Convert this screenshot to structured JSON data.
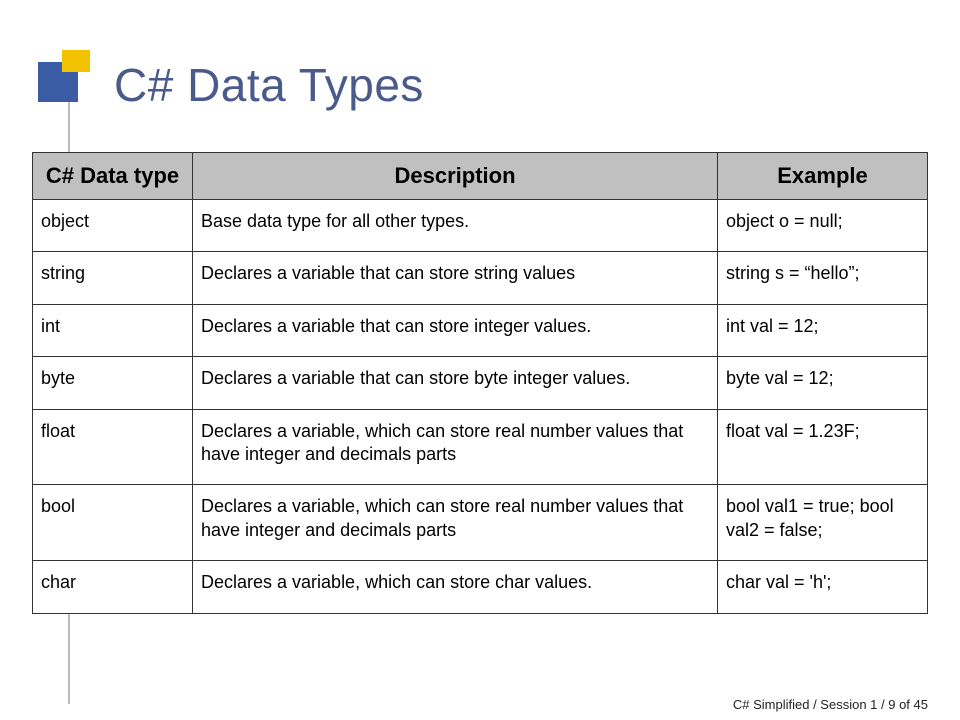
{
  "slide": {
    "title": "C# Data Types",
    "table": {
      "headers": [
        "C# Data type",
        "Description",
        "Example"
      ],
      "rows": [
        {
          "type": "object",
          "description": "Base data type for all other types.",
          "example": "object o = null;"
        },
        {
          "type": "string",
          "description": "Declares a variable that can store string values",
          "example": "string s = “hello”;"
        },
        {
          "type": "int",
          "description": "Declares a variable that can store integer values.",
          "example": "int val = 12;"
        },
        {
          "type": "byte",
          "description": "Declares a variable that can store byte integer values.",
          "example": "byte val = 12;"
        },
        {
          "type": "float",
          "description": "Declares a variable, which can store real number values that have integer and decimals parts",
          "example": "float val = 1.23F;"
        },
        {
          "type": "bool",
          "description": "Declares a variable, which can store real number values that have integer and decimals parts",
          "example": "bool val1 = true; bool val2 = false;"
        },
        {
          "type": "char",
          "description": "Declares a variable, which can store char values.",
          "example": "char val = 'h';"
        }
      ]
    },
    "footer": "C# Simplified / Session 1 / 9 of 45"
  }
}
